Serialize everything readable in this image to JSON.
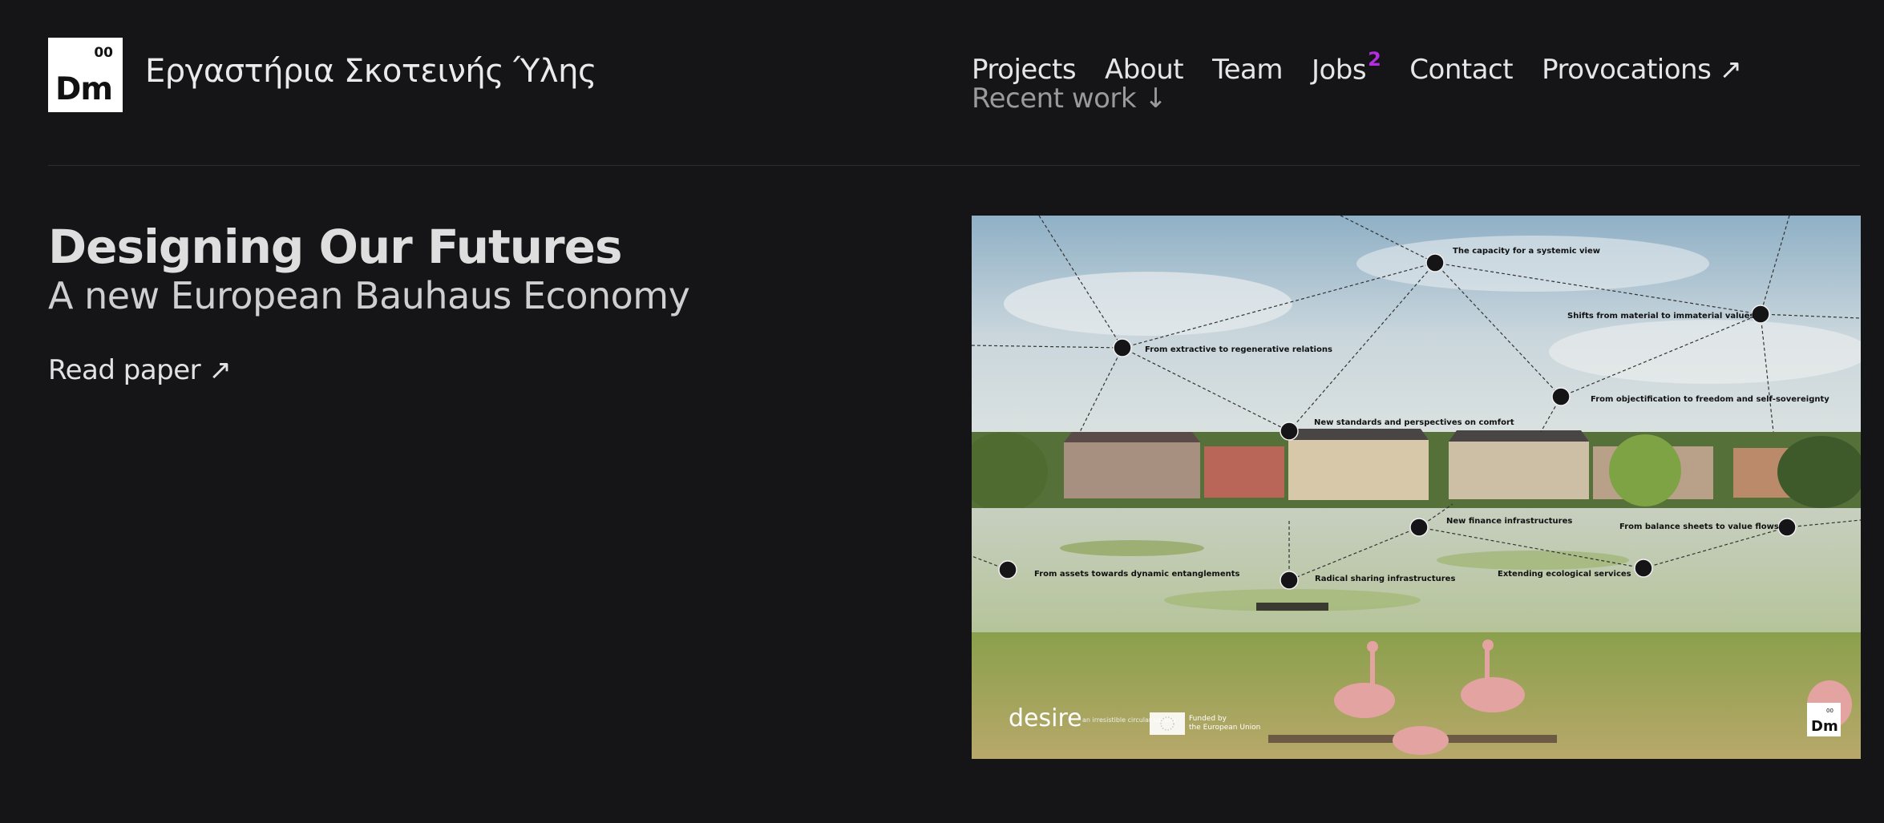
{
  "logo": {
    "number": "00",
    "symbol": "Dm"
  },
  "site_name": "Εργαστήρια Σκοτεινής Ύλης",
  "nav": {
    "items": [
      {
        "label": "Projects"
      },
      {
        "label": "About"
      },
      {
        "label": "Team"
      },
      {
        "label": "Jobs",
        "badge": "2"
      },
      {
        "label": "Contact"
      },
      {
        "label": "Provocations ↗"
      }
    ],
    "recent_work": "Recent work ↓"
  },
  "hero": {
    "title": "Designing Our Futures",
    "subtitle": "A new European Bauhaus Economy",
    "link": "Read paper ↗"
  },
  "image": {
    "labels": [
      "The capacity for a systemic view",
      "Shifts from material to immaterial values",
      "From extractive to regenerative relations",
      "From objectification to freedom and self-sovereignty",
      "New standards and perspectives on comfort",
      "New finance infrastructures",
      "From balance sheets to value flows",
      "From assets towards dynamic entanglements",
      "Radical sharing infrastructures",
      "Extending ecological services"
    ],
    "footer_brand": "desire",
    "footer_brand_tag": "an irresistible circular society",
    "eu_text_1": "Funded by",
    "eu_text_2": "the European Union",
    "corner_symbol": "Dm",
    "corner_number": "00"
  },
  "colors": {
    "background": "#151416",
    "accent": "#b42ee0"
  }
}
